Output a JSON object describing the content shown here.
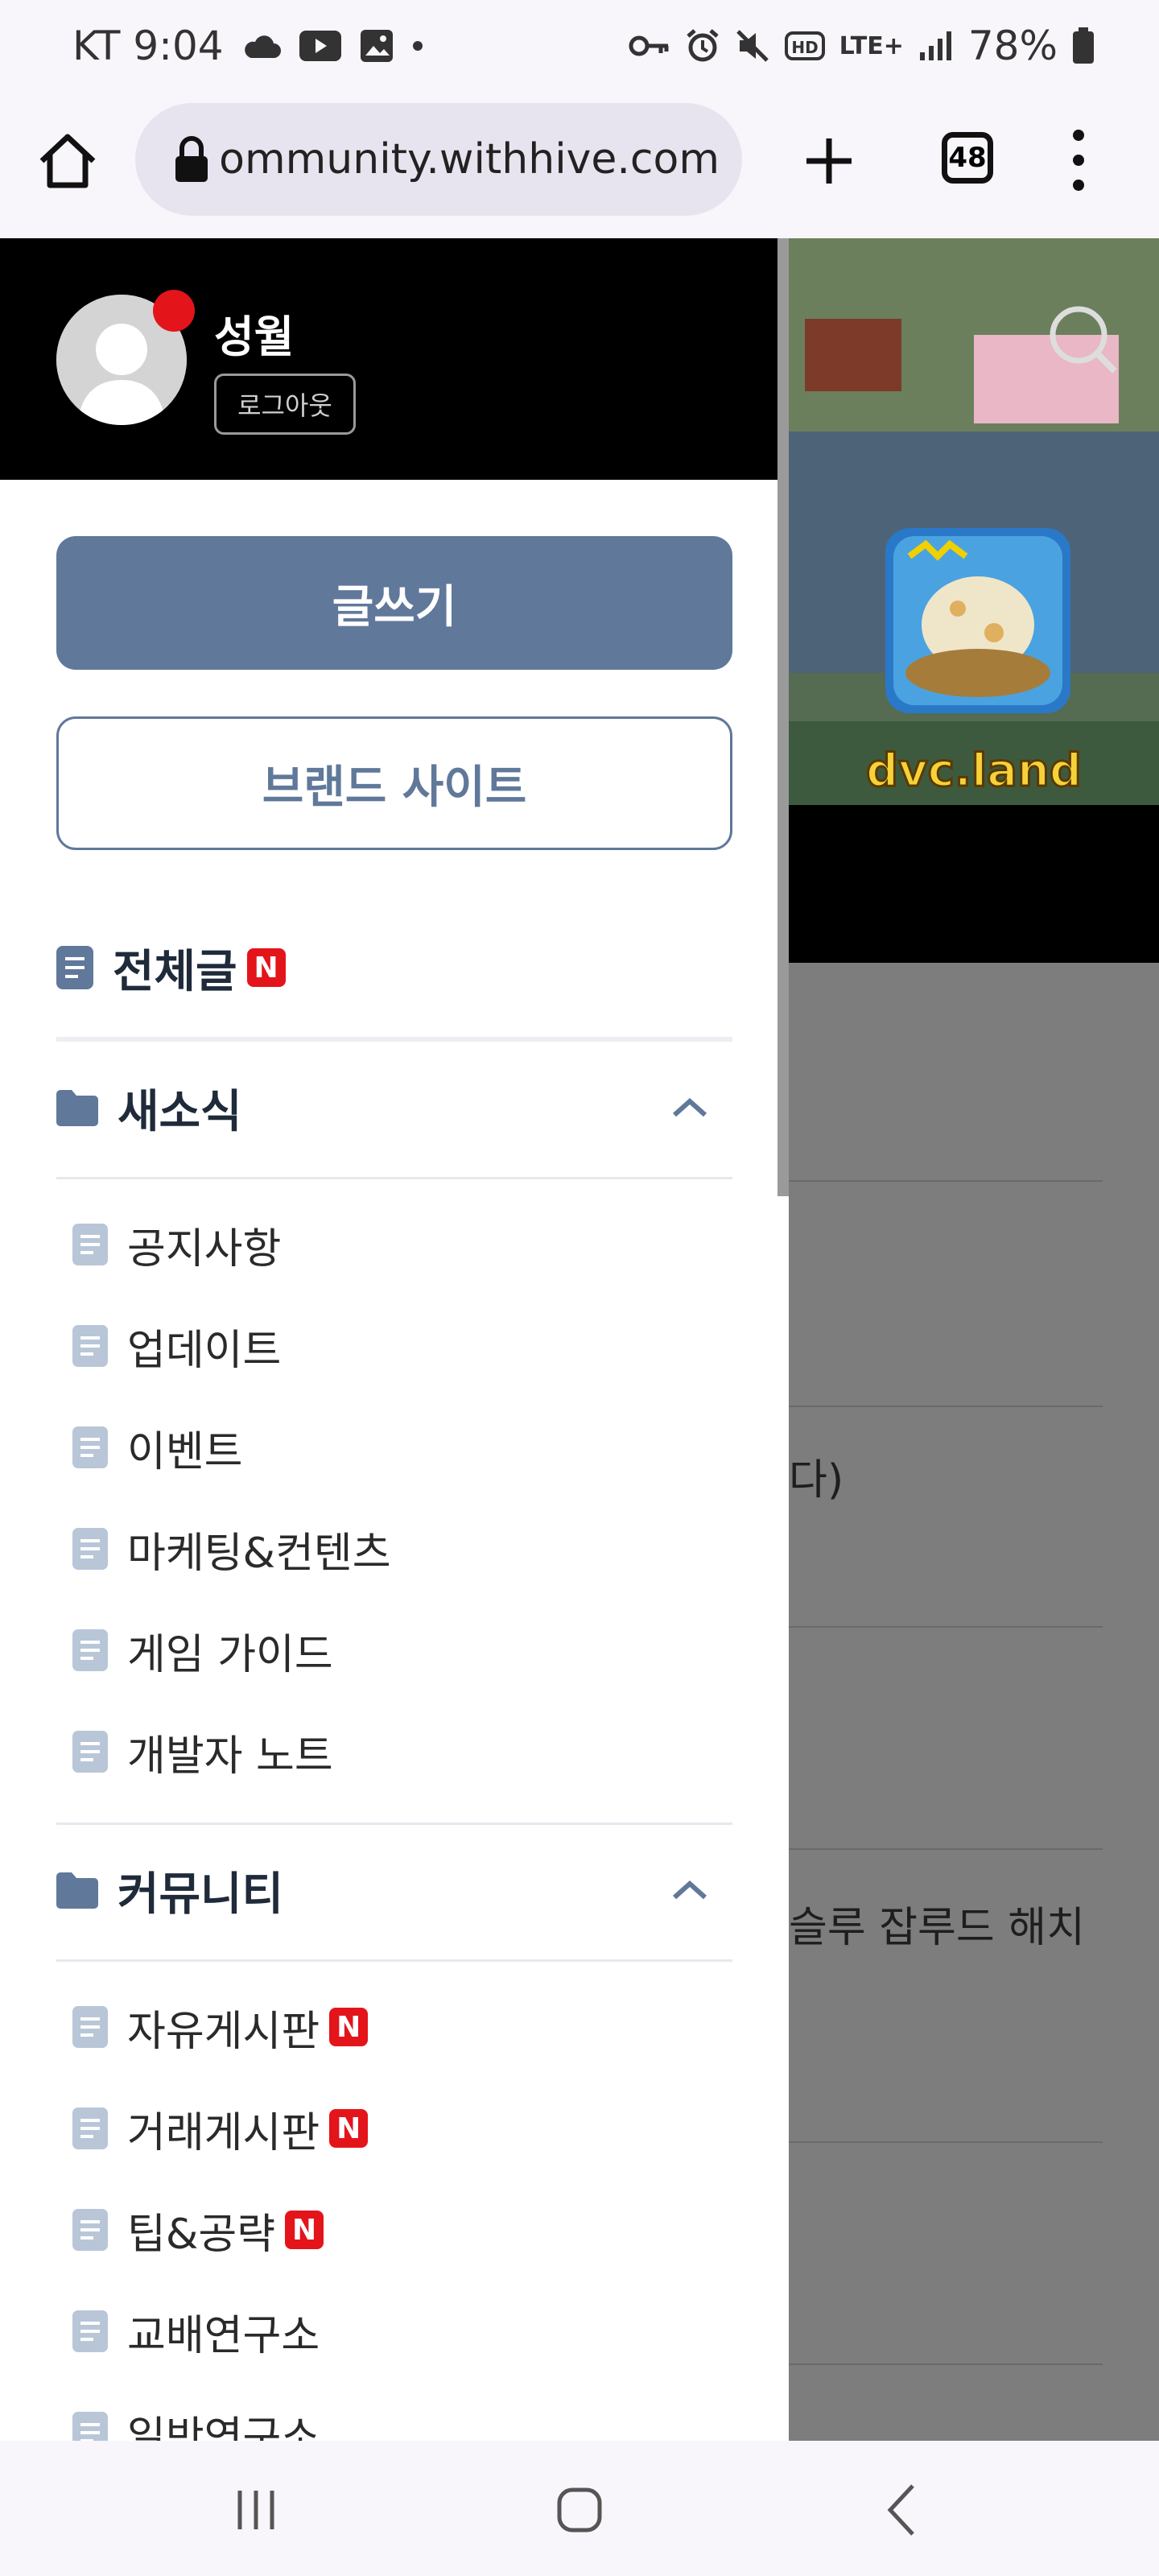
{
  "status_bar": {
    "carrier_time": "KT 9:04",
    "network": "LTE+",
    "battery": "78%"
  },
  "browser": {
    "url": "community.withhive.com",
    "tab_count": "48"
  },
  "profile": {
    "username": "성월",
    "logout_label": "로그아웃"
  },
  "actions": {
    "write_label": "글쓰기",
    "brand_site_label": "브랜드 사이트"
  },
  "menu": {
    "all_posts": {
      "label": "전체글",
      "badge": "N"
    },
    "news": {
      "label": "새소식",
      "items": [
        {
          "label": "공지사항"
        },
        {
          "label": "업데이트"
        },
        {
          "label": "이벤트"
        },
        {
          "label": "마케팅&컨텐츠"
        },
        {
          "label": "게임 가이드"
        },
        {
          "label": "개발자 노트"
        }
      ]
    },
    "community": {
      "label": "커뮤니티",
      "items": [
        {
          "label": "자유게시판",
          "badge": "N"
        },
        {
          "label": "거래게시판",
          "badge": "N"
        },
        {
          "label": "팁&공략",
          "badge": "N"
        },
        {
          "label": "교배연구소"
        },
        {
          "label": "일반연구소"
        }
      ]
    }
  },
  "background_page": {
    "banner_text": "dvc.land",
    "snippet_1": "다)",
    "snippet_2": "슬루 잡루드 해치"
  },
  "colors": {
    "accent": "#60789a",
    "badge_red": "#e4141b",
    "header_black": "#000000"
  }
}
